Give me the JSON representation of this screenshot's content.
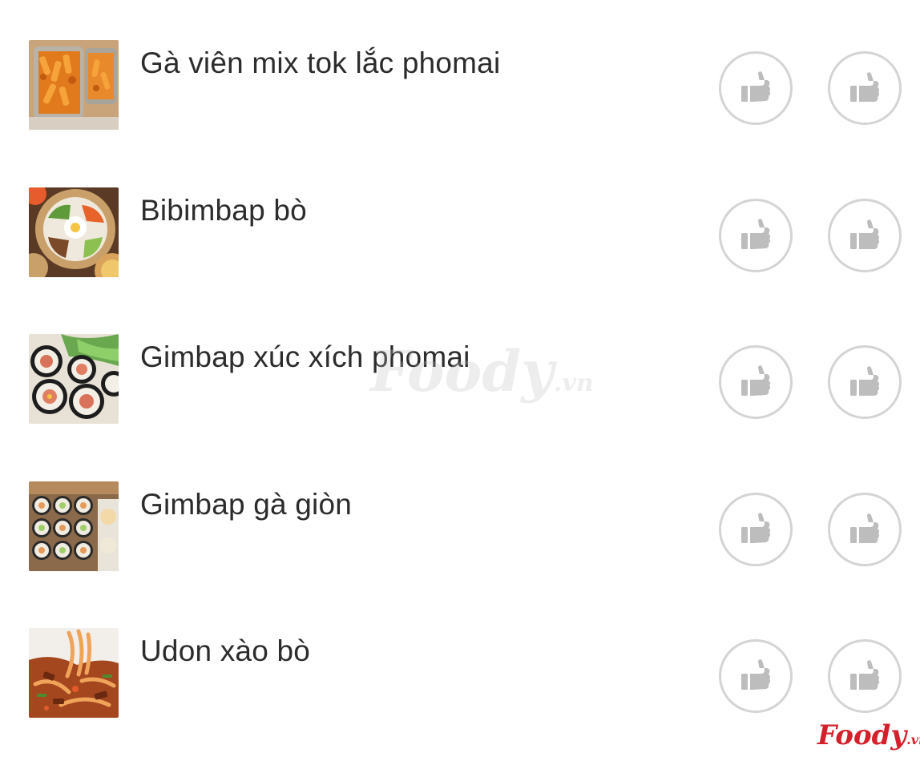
{
  "menu_items": [
    {
      "name": "Gà viên mix tok lắc phomai",
      "thumbnail_icon": "fried-chicken-tteokbokki-photo"
    },
    {
      "name": "Bibimbap bò",
      "thumbnail_icon": "bibimbap-bowl-photo"
    },
    {
      "name": "Gimbap xúc xích phomai",
      "thumbnail_icon": "sausage-gimbap-photo"
    },
    {
      "name": "Gimbap gà giòn",
      "thumbnail_icon": "crispy-chicken-gimbap-photo"
    },
    {
      "name": "Udon xào bò",
      "thumbnail_icon": "stir-fried-udon-photo"
    }
  ],
  "actions": {
    "dislike_icon": "thumbs-down-icon",
    "like_icon": "thumbs-up-icon"
  },
  "watermark": {
    "text": "Foody",
    "suffix": ".vn"
  },
  "brand": {
    "text": "Foody",
    "suffix": ".vn"
  },
  "colors": {
    "text": "#2c2c2c",
    "icon_gray": "#bdbdbd",
    "circle_border": "#d4d4d4",
    "brand_red": "#d4202b"
  }
}
